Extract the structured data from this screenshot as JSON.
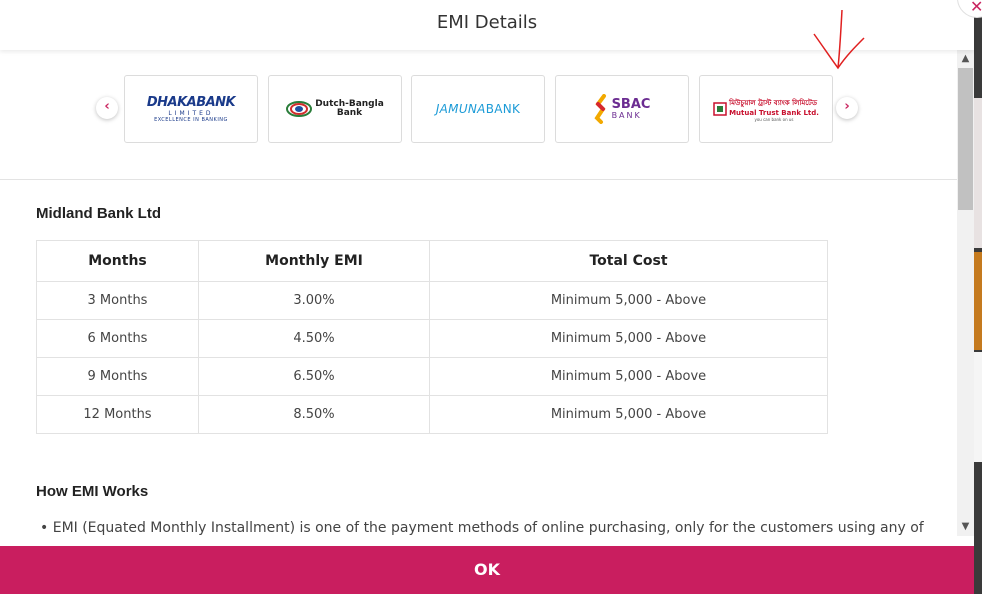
{
  "modal": {
    "title": "EMI Details",
    "close_icon": "close-icon",
    "ok_label": "OK"
  },
  "colors": {
    "accent": "#c91e5f",
    "annotation": "#e02020"
  },
  "carousel": {
    "prev_icon": "chevron-left-icon",
    "next_icon": "chevron-right-icon",
    "banks": [
      {
        "name": "DHAKABANK",
        "line2": "LIMITED",
        "line3": "EXCELLENCE IN BANKING"
      },
      {
        "name": "Dutch-Bangla",
        "line2": "Bank"
      },
      {
        "name_a": "JAMUNA",
        "name_b": "BANK"
      },
      {
        "name": "SBAC",
        "line2": "BANK"
      },
      {
        "name_bn": "মিউচুয়াল ট্রাস্ট ব্যাংক লিমিটেড",
        "name": "Mutual Trust Bank Ltd.",
        "tagline": "you can bank on us"
      }
    ]
  },
  "emi_table": {
    "bank_title": "Midland Bank Ltd",
    "headers": [
      "Months",
      "Monthly EMI",
      "Total Cost"
    ],
    "rows": [
      [
        "3 Months",
        "3.00%",
        "Minimum 5,000 - Above"
      ],
      [
        "6 Months",
        "4.50%",
        "Minimum 5,000 - Above"
      ],
      [
        "9 Months",
        "6.50%",
        "Minimum 5,000 - Above"
      ],
      [
        "12 Months",
        "8.50%",
        "Minimum 5,000 - Above"
      ]
    ]
  },
  "how_emi": {
    "title": "How EMI Works",
    "bullet": "EMI (Equated Monthly Installment) is one of the payment methods of online purchasing, only for the customers using any of"
  }
}
